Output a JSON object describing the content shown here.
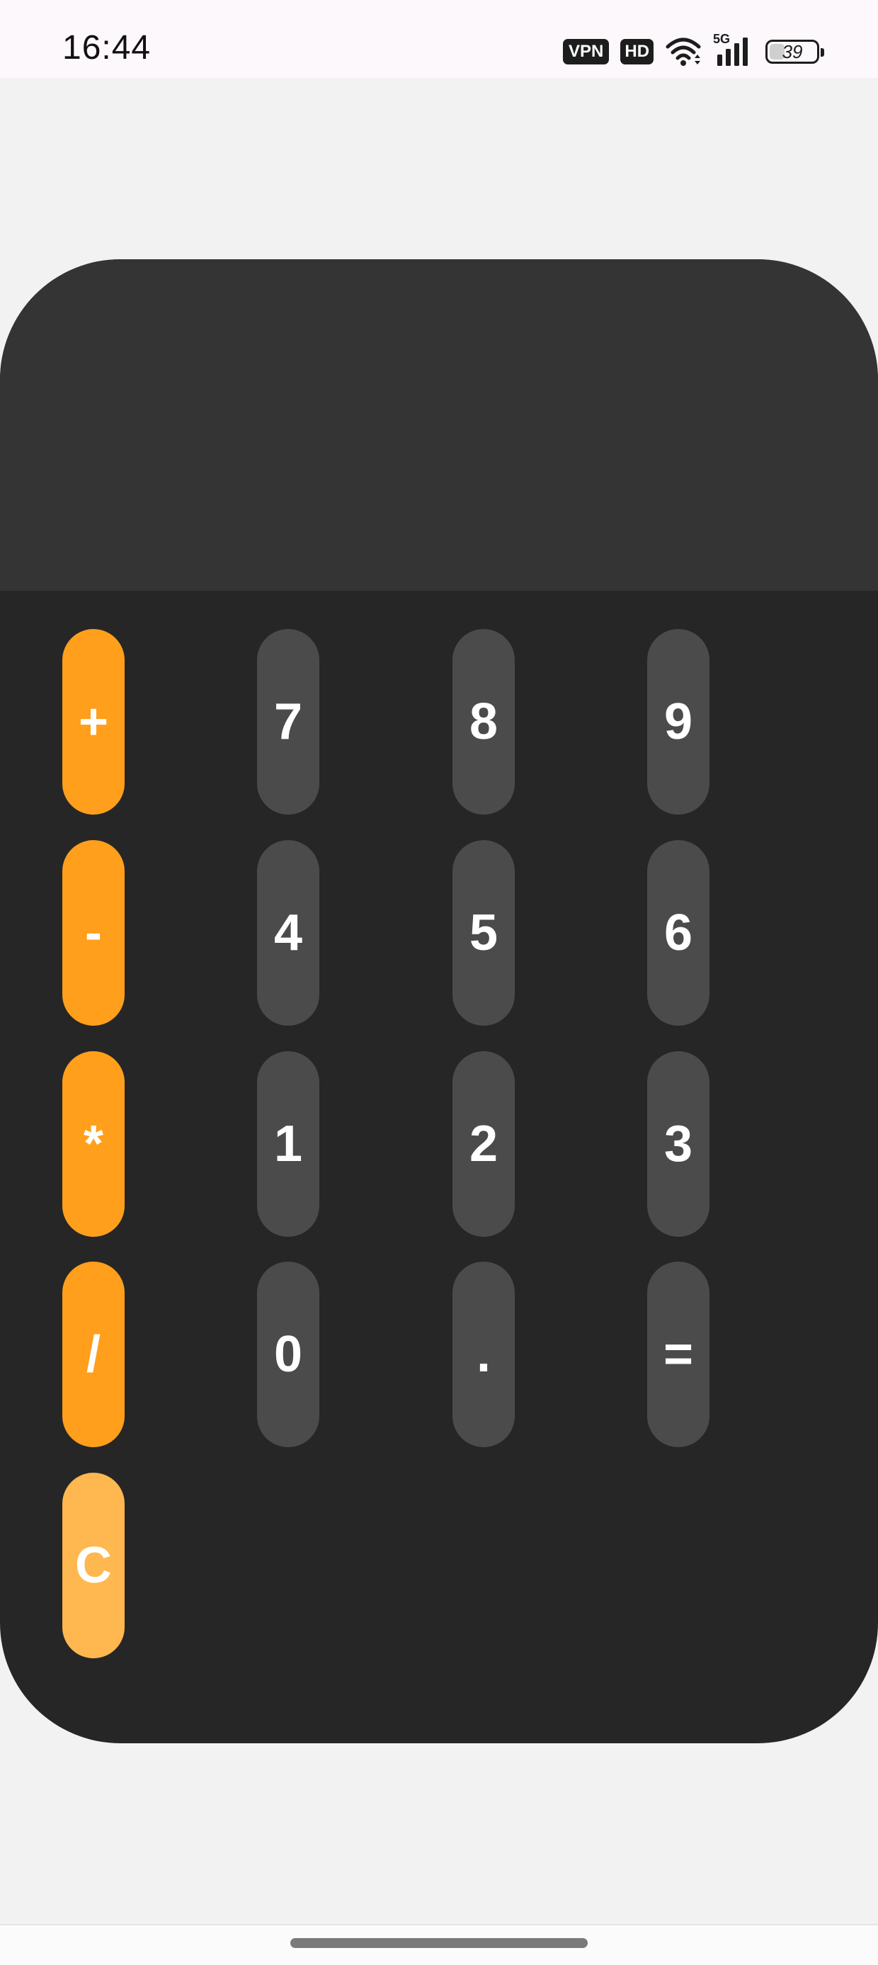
{
  "status_bar": {
    "time": "16:44",
    "vpn_badge": "VPN",
    "hd_badge": "HD",
    "network_label": "5G",
    "battery_level": "39",
    "battery_fraction": 0.39,
    "icons": [
      "vpn-badge",
      "hd-badge",
      "wifi-icon",
      "cellular-signal-icon",
      "battery-icon"
    ]
  },
  "calculator": {
    "display_value": "",
    "keys": {
      "plus": "+",
      "seven": "7",
      "eight": "8",
      "nine": "9",
      "minus": "-",
      "four": "4",
      "five": "5",
      "six": "6",
      "multiply": "*",
      "one": "1",
      "two": "2",
      "three": "3",
      "divide": "/",
      "zero": "0",
      "decimal": ".",
      "equals": "=",
      "clear": "C"
    }
  },
  "colors": {
    "operator": "#ff9f1c",
    "clear": "#ffb74f",
    "number": "#4b4b4b",
    "keypad_background": "#262626",
    "display_background": "#343434",
    "page_background": "#f2f2f2"
  }
}
